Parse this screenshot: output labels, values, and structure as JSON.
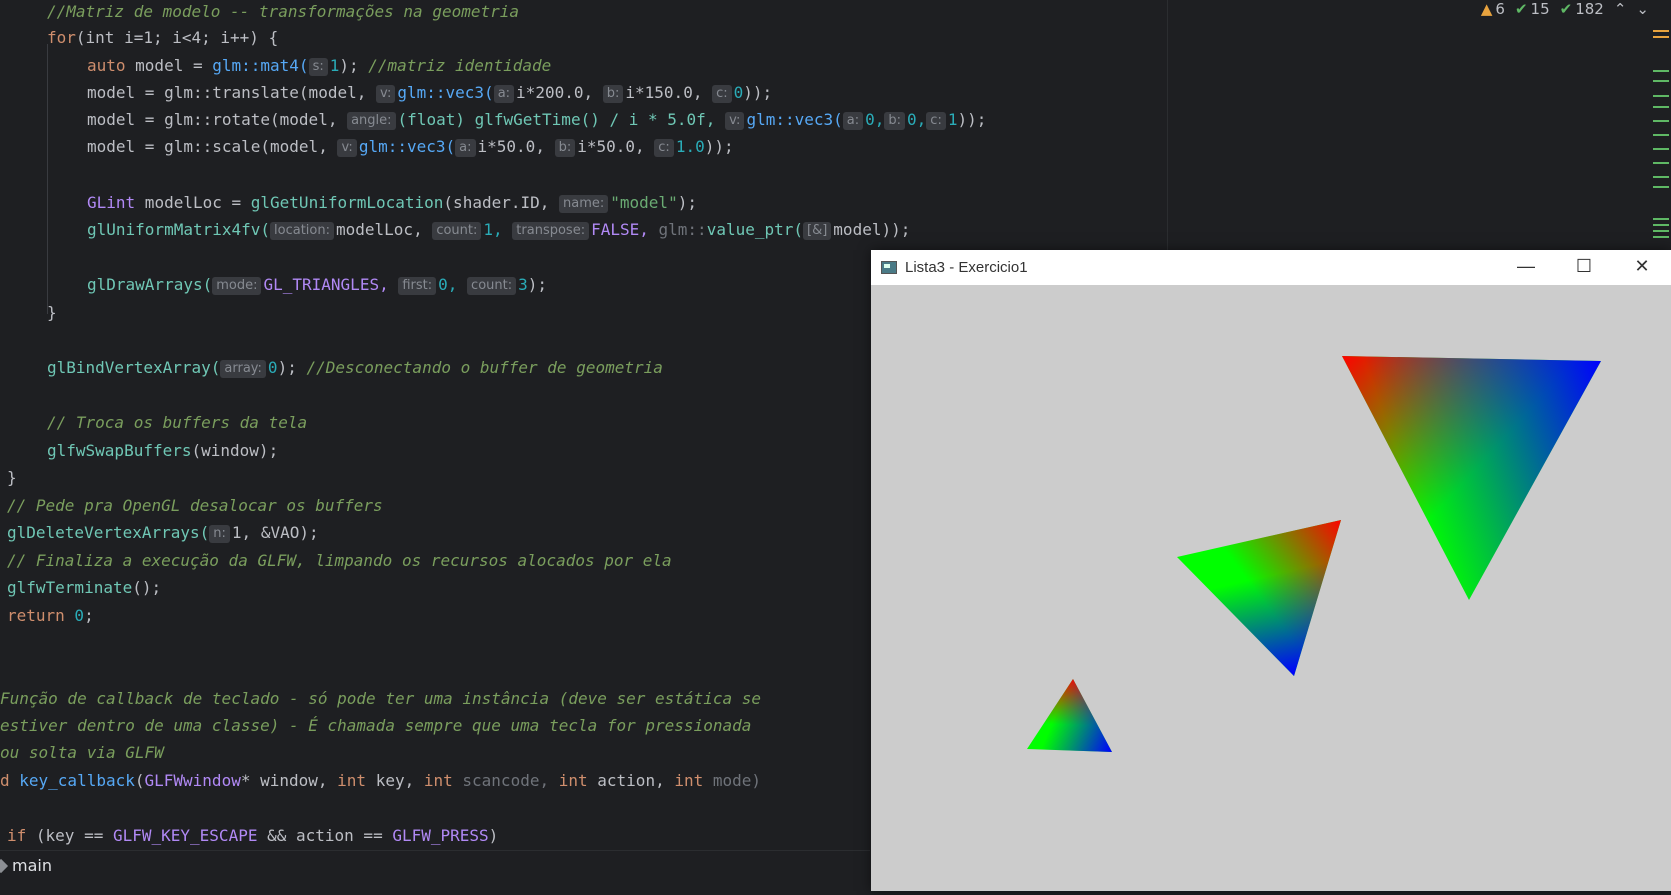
{
  "status": {
    "warnings": "6",
    "weak_warnings": "15",
    "typos": "182"
  },
  "code": {
    "l1": "//Matriz de modelo -- transformações na geometria",
    "for_kw": "for",
    "for_rest": "(int i=1; i<4; i++) {",
    "l3_a": "auto",
    "l3_b": " model = ",
    "l3_c": "glm::mat4(",
    "l3_h": "s:",
    "l3_d": "1",
    "l3_e": "); ",
    "l3_cm": "//matriz identidade",
    "l4": "model = glm::translate(model, ",
    "l4_hv": "v:",
    "l4_v": "glm::vec3(",
    "l4_ha": "a:",
    "l4_a": "i*200.0, ",
    "l4_hb": "b:",
    "l4_b": "i*150.0, ",
    "l4_hc": "c:",
    "l4_c": "0",
    "l4_end": "));",
    "l5": "model = glm::rotate(model, ",
    "l5_hangle": "angle:",
    "l5_ang": "(float) glfwGetTime() / i * 5.0f, ",
    "l5_hv": "v:",
    "l5_v": "glm::vec3(",
    "l5_ha": "a:",
    "l5_a": "0,",
    "l5_hb": "b:",
    "l5_b": "0,",
    "l5_hc": "c:",
    "l5_c": "1",
    "l5_end": "));",
    "l6": "model = glm::scale(model, ",
    "l6_hv": "v:",
    "l6_v": "glm::vec3(",
    "l6_ha": "a:",
    "l6_a": "i*50.0, ",
    "l6_hb": "b:",
    "l6_b": "i*50.0, ",
    "l6_hc": "c:",
    "l6_c": "1.0",
    "l6_end": "));",
    "l8_t": "GLint",
    "l8_v": " modelLoc = ",
    "l8_f": "glGetUniformLocation",
    "l8_a": "(shader.ID, ",
    "l8_h": "name:",
    "l8_s": "\"model\"",
    "l8_end": ");",
    "l9_f": "glUniformMatrix4fv(",
    "l9_h1": "location:",
    "l9_a1": "modelLoc, ",
    "l9_h2": "count:",
    "l9_a2": "1, ",
    "l9_h3": "transpose:",
    "l9_a3": "FALSE, ",
    "l9_ns": "glm::",
    "l9_f2": "value_ptr(",
    "l9_h4": "[&]",
    "l9_a4": "model));",
    "l11_f": "glDrawArrays(",
    "l11_h1": "mode:",
    "l11_a1": "GL_TRIANGLES, ",
    "l11_h2": "first:",
    "l11_a2": "0, ",
    "l11_h3": "count:",
    "l11_a3": "3",
    "l11_end": ");",
    "l12": "}",
    "l14_f": "glBindVertexArray(",
    "l14_h": "array:",
    "l14_a": "0",
    "l14_e": "); ",
    "l14_cm": "//Desconectando o buffer de geometria",
    "l16_cm": "// Troca os buffers da tela",
    "l17_f": "glfwSwapBuffers",
    "l17_a": "(window);",
    "l18": "}",
    "l19_cm": "// Pede pra OpenGL desalocar os buffers",
    "l20_f": "glDeleteVertexArrays(",
    "l20_h": "n:",
    "l20_a": "1, &VAO);",
    "l21_cm": "// Finaliza a execução da GLFW, limpando os recursos alocados por ela",
    "l22_f": "glfwTerminate",
    "l22_a": "();",
    "l23_k": "return",
    "l23_n": " 0",
    "l23_e": ";",
    "l26_cm": "Função de callback de teclado - só pode ter uma instância (deve ser estática se",
    "l27_cm": "estiver dentro de uma classe) - É chamada sempre que uma tecla for pressionada",
    "l28_cm": "ou solta via GLFW",
    "l29_a": "d ",
    "l29_f": "key_callback",
    "l29_b": "(",
    "l29_t": "GLFWwindow",
    "l29_c": "* window, ",
    "l29_k1": "int",
    "l29_d": " key, ",
    "l29_k2": "int",
    "l29_e": " scancode, ",
    "l29_k3": "int",
    "l29_g": " action, ",
    "l29_k4": "int",
    "l29_h": " mode)",
    "l31_k": "if",
    "l31_a": " (key == ",
    "l31_m1": "GLFW_KEY_ESCAPE",
    "l31_b": " && action == ",
    "l31_m2": "GLFW_PRESS",
    "l31_c": ")"
  },
  "bottom_bar": {
    "label": "main"
  },
  "window": {
    "title": "Lista3 - Exercicio1",
    "minimize": "—",
    "maximize": "☐",
    "close": "✕",
    "background": "#cccccc"
  },
  "icons": [
    "warning-icon",
    "check-icon",
    "double-check-icon",
    "chevron-up-icon",
    "chevron-down-icon",
    "app-icon",
    "minimize-icon",
    "maximize-icon",
    "close-icon",
    "cube-icon"
  ]
}
